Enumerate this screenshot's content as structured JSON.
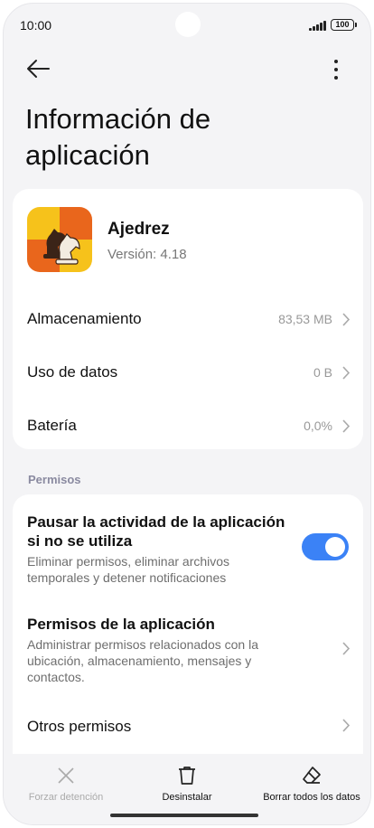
{
  "status_bar": {
    "time": "10:00",
    "battery": "100"
  },
  "toolbar": {
    "back_icon": "arrow-left-icon",
    "more_icon": "more-vertical-icon"
  },
  "page_title": "Información de aplicación",
  "app": {
    "name": "Ajedrez",
    "version": "Versión: 4.18",
    "icon": "chess-knight-icon"
  },
  "summary_rows": [
    {
      "label": "Almacenamiento",
      "value": "83,53 MB"
    },
    {
      "label": "Uso de datos",
      "value": "0 B"
    },
    {
      "label": "Batería",
      "value": "0,0%"
    }
  ],
  "permissions": {
    "section_label": "Permisos",
    "pause": {
      "title": "Pausar la actividad de la aplicación si no se utiliza",
      "description": "Eliminar permisos, eliminar archivos temporales y detener notificaciones",
      "enabled": true
    },
    "app_permissions": {
      "title": "Permisos de la aplicación",
      "description": "Administrar permisos relacionados con la ubicación, almacenamiento, mensajes y contactos."
    },
    "other": {
      "title": "Otros permisos"
    }
  },
  "bottom_actions": [
    {
      "label": "Forzar detención",
      "icon": "close-icon",
      "enabled": false
    },
    {
      "label": "Desinstalar",
      "icon": "trash-icon",
      "enabled": true
    },
    {
      "label": "Borrar todos los datos",
      "icon": "eraser-icon",
      "enabled": true
    }
  ],
  "colors": {
    "accent": "#3b82f6",
    "background": "#f4f4f6",
    "card": "#ffffff"
  }
}
